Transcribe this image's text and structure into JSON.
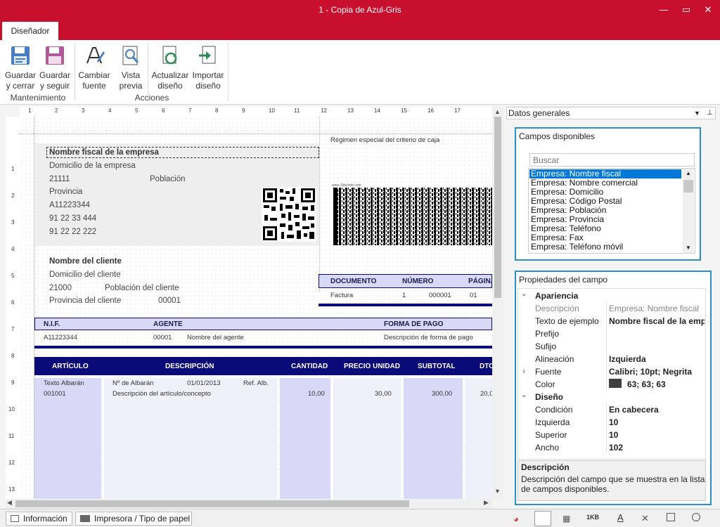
{
  "window": {
    "title": "1 - Copia de Azul-Gris",
    "min": "—",
    "max": "▭",
    "close": "✕"
  },
  "ribbon": {
    "tab": "Diseñador",
    "buttons": {
      "guardar_cerrar": [
        "Guardar",
        "y cerrar"
      ],
      "guardar_seguir": [
        "Guardar",
        "y seguir"
      ],
      "cambiar_fuente": [
        "Cambiar",
        "fuente"
      ],
      "vista_previa": [
        "Vista",
        "previa"
      ],
      "actualizar_diseno": [
        "Actualizar",
        "diseño"
      ],
      "importar_diseno": [
        "Importar",
        "diseño"
      ]
    },
    "groups": {
      "mantenimiento": "Mantenimiento",
      "acciones": "Acciones"
    }
  },
  "ruler": {
    "top": [
      "1",
      "2",
      "3",
      "4",
      "5",
      "6",
      "7",
      "8",
      "9",
      "10",
      "11",
      "12",
      "13",
      "14",
      "15",
      "16",
      "17"
    ],
    "left": [
      "1",
      "2",
      "3",
      "4",
      "5",
      "6",
      "7",
      "8",
      "9",
      "10",
      "11",
      "12",
      "13"
    ]
  },
  "document": {
    "company": {
      "name": "Nombre fiscal de la empresa",
      "address": "Domicilio de la empresa",
      "postal": "21111",
      "city": "Población",
      "province": "Provincia",
      "nif": "A11223344",
      "phone": "91 22 33 444",
      "fax": "91 22 22 222"
    },
    "regime": "Régimen especial del criterio de caja",
    "barcode_caption": "www.1kbcode.com",
    "client": {
      "name": "Nombre del cliente",
      "address": "Domicilio del cliente",
      "postal": "21000",
      "city": "Población del cliente",
      "province": "Provincia del cliente",
      "code": "00001"
    },
    "doc_header": {
      "documento": "DOCUMENTO",
      "numero": "NÚMERO",
      "pagina": "PÁGINA"
    },
    "doc_values": {
      "documento": "Factura",
      "numero1": "1",
      "numero2": "000001",
      "pagina": "01"
    },
    "info_header": {
      "nif": "N.I.F.",
      "agente": "AGENTE",
      "forma_pago": "FORMA DE PAGO"
    },
    "info_values": {
      "nif": "A11223344",
      "agente_code": "00001",
      "agente_name": "Nombre del agente",
      "forma_pago": "Descripción de forma de pago"
    },
    "lines_header": {
      "articulo": "ARTÍCULO",
      "descripcion": "DESCRIPCIÓN",
      "cantidad": "CANTIDAD",
      "precio": "PRECIO UNIDAD",
      "subtotal": "SUBTOTAL",
      "dto": "DTO"
    },
    "line": {
      "albaran_label": "Texto Albarán",
      "codigo": "001001",
      "nro_albaran": "Nº de Albarán",
      "fecha": "01/01/2013",
      "ref": "Ref. Alb.",
      "descripcion": "Descripción del artículo/concepto",
      "cantidad": "10,00",
      "precio": "30,00",
      "subtotal": "300,00",
      "dto": "20,0"
    }
  },
  "status": {
    "informacion": "Información",
    "impresora": "Impresora / Tipo de papel"
  },
  "panel": {
    "dropdown": "Datos generales",
    "campos": {
      "title": "Campos disponibles",
      "search_placeholder": "Buscar",
      "items": [
        "Empresa: Nombre fiscal",
        "Empresa: Nombre comercial",
        "Empresa: Domicilio",
        "Empresa: Código Postal",
        "Empresa: Población",
        "Empresa: Provincia",
        "Empresa: Teléfono",
        "Empresa: Fax",
        "Empresa: Teléfono móvil"
      ]
    },
    "props": {
      "title": "Propiedades del campo",
      "apariencia": "Apariencia",
      "descripcion_label": "Descripción",
      "descripcion_value": "Empresa: Nombre fiscal",
      "texto_label": "Texto de ejemplo",
      "texto_value": "Nombre fiscal de la empresa",
      "prefijo_label": "Prefijo",
      "sufijo_label": "Sufijo",
      "alineacion_label": "Alineación",
      "alineacion_value": "Izquierda",
      "fuente_label": "Fuente",
      "fuente_value": "Calibri; 10pt; Negrita",
      "color_label": "Color",
      "color_value": "63; 63; 63",
      "color_hex": "#3f3f3f",
      "diseno": "Diseño",
      "condicion_label": "Condición",
      "condicion_value": "En cabecera",
      "izquierda_label": "Izquierda",
      "izquierda_value": "10",
      "superior_label": "Superior",
      "superior_value": "10",
      "ancho_label": "Ancho",
      "ancho_value": "102"
    },
    "desc": {
      "title": "Descripción",
      "text1": "Descripción del campo que se muestra en la lista",
      "text2": "de campos disponibles."
    }
  },
  "colors": {
    "accent": "#c8102e",
    "navy": "#0a0a78",
    "lavender": "#d9d9f7",
    "panel_border": "#2d8fc8",
    "selection": "#0078d7"
  }
}
